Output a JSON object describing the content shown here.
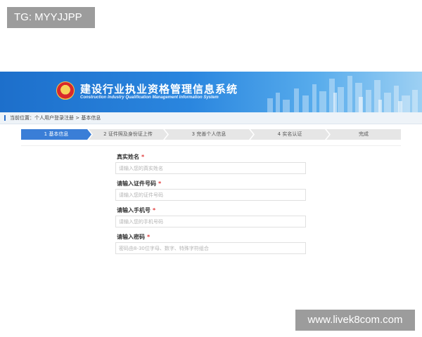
{
  "watermarks": {
    "top": "TG: MYYJJPP",
    "bottom": "www.livek8com.com"
  },
  "header": {
    "title": "建设行业执业资格管理信息系统",
    "subtitle": "Construction Industry Qualification Management Information System",
    "emblem_icon": "national-emblem-icon",
    "colors": {
      "banner_start": "#1d6fcb",
      "banner_end": "#9dd0f3"
    }
  },
  "breadcrumb": {
    "text": "当前位置：个人用户登录注册 > 基本信息"
  },
  "steps": [
    {
      "label": "1 基本信息",
      "active": true
    },
    {
      "label": "2 证件照及身份证上传",
      "active": false
    },
    {
      "label": "3 完善个人信息",
      "active": false
    },
    {
      "label": "4 实名认证",
      "active": false
    },
    {
      "label": "完成",
      "active": false
    }
  ],
  "form": {
    "required_mark": "*",
    "fields": [
      {
        "label": "真实姓名",
        "placeholder": "请输入您的真实姓名",
        "value": ""
      },
      {
        "label": "请输入证件号码",
        "placeholder": "请输入您的证件号码",
        "value": ""
      },
      {
        "label": "请输入手机号",
        "placeholder": "请输入您的手机号码",
        "value": ""
      },
      {
        "label": "请输入密码",
        "placeholder": "密码由8-30位字母、数字、特殊字符组合",
        "value": ""
      }
    ]
  },
  "accent_color": "#3a7ed7"
}
